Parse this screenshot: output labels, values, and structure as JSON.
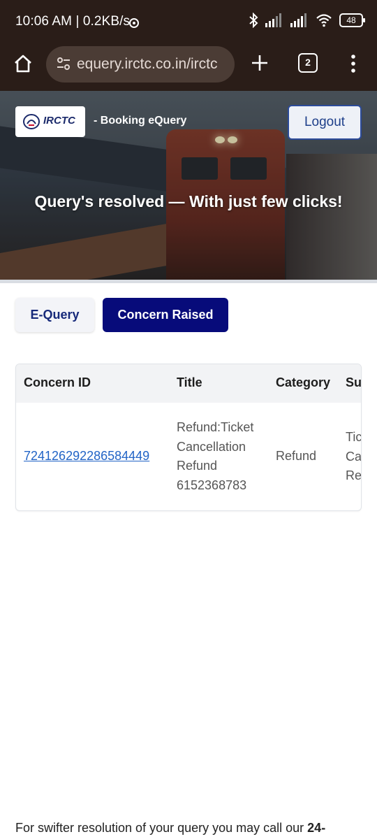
{
  "status_bar": {
    "time_text": "10:06 AM | 0.2KB/s",
    "battery_level": "48",
    "icons": [
      "chat-notification-icon",
      "bluetooth-icon",
      "signal-icon",
      "signal-icon",
      "wifi-icon",
      "battery-icon"
    ]
  },
  "browser": {
    "url": "equery.irctc.co.in/irctc",
    "tab_count": "2",
    "icons": [
      "home-icon",
      "site-settings-icon",
      "plus-icon",
      "tabs-icon",
      "more-vert-icon"
    ]
  },
  "header": {
    "logo_text": "IRCTC",
    "subtitle": "- Booking eQuery",
    "logout_label": "Logout",
    "tagline": "Query's resolved — With just few clicks!"
  },
  "tabs": [
    {
      "label": "E-Query",
      "active": false
    },
    {
      "label": "Concern Raised",
      "active": true
    }
  ],
  "table": {
    "columns": [
      "Concern ID",
      "Title",
      "Category",
      "Su"
    ],
    "rows": [
      {
        "concern_id": "724126292286584449",
        "title_lines": [
          "Refund:Ticket",
          "Cancellation",
          "Refund",
          "6152368783"
        ],
        "category": "Refund",
        "sub_lines": [
          "Tic",
          "Ca",
          "Re"
        ]
      }
    ]
  },
  "footer": {
    "text": "For swifter resolution of your query you may call our ",
    "bold_text": "24-"
  },
  "colors": {
    "active_tab": "#070b7a",
    "link": "#2264c6",
    "browser_bar": "#2a1d18"
  }
}
